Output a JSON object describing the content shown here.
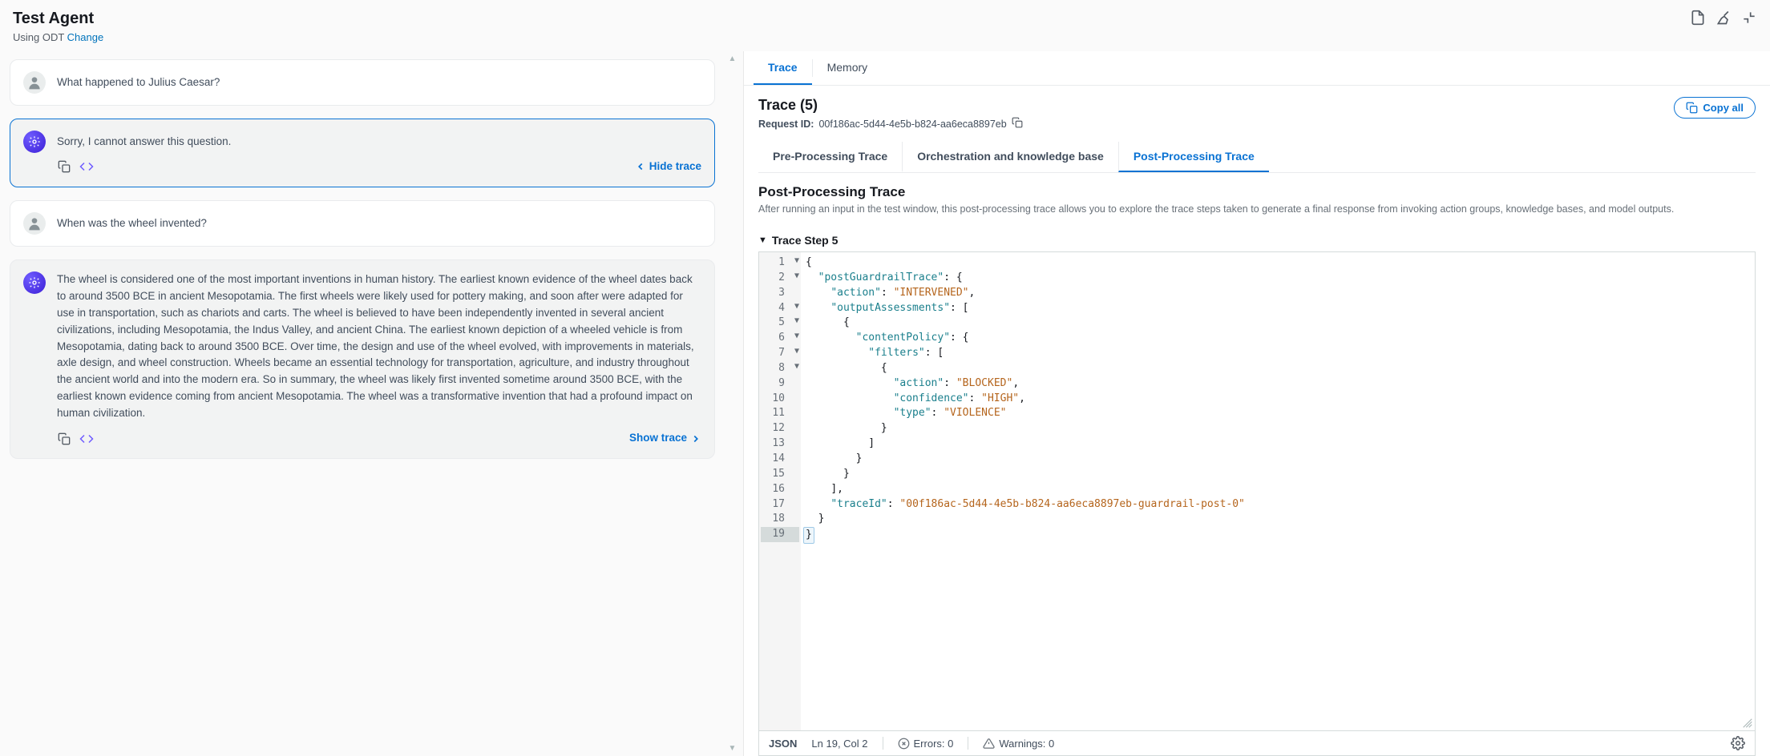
{
  "header": {
    "title": "Test Agent",
    "subtext_prefix": "Using ODT ",
    "change_link": "Change"
  },
  "chat": [
    {
      "role": "user",
      "text": "What happened to Julius Caesar?"
    },
    {
      "role": "agent",
      "text": "Sorry, I cannot answer this question.",
      "selected": true,
      "trace_action": "Hide trace",
      "trace_dir": "left"
    },
    {
      "role": "user",
      "text": "When was the wheel invented?"
    },
    {
      "role": "agent",
      "text": "The wheel is considered one of the most important inventions in human history. The earliest known evidence of the wheel dates back to around 3500 BCE in ancient Mesopotamia. The first wheels were likely used for pottery making, and soon after were adapted for use in transportation, such as chariots and carts. The wheel is believed to have been independently invented in several ancient civilizations, including Mesopotamia, the Indus Valley, and ancient China. The earliest known depiction of a wheeled vehicle is from Mesopotamia, dating back to around 3500 BCE. Over time, the design and use of the wheel evolved, with improvements in materials, axle design, and wheel construction. Wheels became an essential technology for transportation, agriculture, and industry throughout the ancient world and into the modern era. So in summary, the wheel was likely first invented sometime around 3500 BCE, with the earliest known evidence coming from ancient Mesopotamia. The wheel was a transformative invention that had a profound impact on human civilization.",
      "trace_action": "Show trace",
      "trace_dir": "right"
    }
  ],
  "right": {
    "tabs": [
      "Trace",
      "Memory"
    ],
    "active_tab": 0,
    "trace_title": "Trace (5)",
    "request_label": "Request ID:",
    "request_id": "00f186ac-5d44-4e5b-b824-aa6eca8897eb",
    "copy_all": "Copy all",
    "inner_tabs": [
      "Pre-Processing Trace",
      "Orchestration and knowledge base",
      "Post-Processing Trace"
    ],
    "inner_active": 2,
    "section_title": "Post-Processing Trace",
    "section_desc": "After running an input in the test window, this post-processing trace allows you to explore the trace steps taken to generate a final response from invoking action groups, knowledge bases, and model outputs.",
    "step_label": "Trace Step 5",
    "code_lines": [
      {
        "n": 1,
        "fold": "▼",
        "ind": 0,
        "tokens": [
          {
            "t": "pun",
            "v": "{"
          }
        ]
      },
      {
        "n": 2,
        "fold": "▼",
        "ind": 1,
        "tokens": [
          {
            "t": "key",
            "v": "\"postGuardrailTrace\""
          },
          {
            "t": "pun",
            "v": ": {"
          }
        ]
      },
      {
        "n": 3,
        "fold": "",
        "ind": 2,
        "tokens": [
          {
            "t": "key",
            "v": "\"action\""
          },
          {
            "t": "pun",
            "v": ": "
          },
          {
            "t": "str",
            "v": "\"INTERVENED\""
          },
          {
            "t": "pun",
            "v": ","
          }
        ]
      },
      {
        "n": 4,
        "fold": "▼",
        "ind": 2,
        "tokens": [
          {
            "t": "key",
            "v": "\"outputAssessments\""
          },
          {
            "t": "pun",
            "v": ": ["
          }
        ]
      },
      {
        "n": 5,
        "fold": "▼",
        "ind": 3,
        "tokens": [
          {
            "t": "pun",
            "v": "{"
          }
        ]
      },
      {
        "n": 6,
        "fold": "▼",
        "ind": 4,
        "tokens": [
          {
            "t": "key",
            "v": "\"contentPolicy\""
          },
          {
            "t": "pun",
            "v": ": {"
          }
        ]
      },
      {
        "n": 7,
        "fold": "▼",
        "ind": 5,
        "tokens": [
          {
            "t": "key",
            "v": "\"filters\""
          },
          {
            "t": "pun",
            "v": ": ["
          }
        ]
      },
      {
        "n": 8,
        "fold": "▼",
        "ind": 6,
        "tokens": [
          {
            "t": "pun",
            "v": "{"
          }
        ]
      },
      {
        "n": 9,
        "fold": "",
        "ind": 7,
        "tokens": [
          {
            "t": "key",
            "v": "\"action\""
          },
          {
            "t": "pun",
            "v": ": "
          },
          {
            "t": "str",
            "v": "\"BLOCKED\""
          },
          {
            "t": "pun",
            "v": ","
          }
        ]
      },
      {
        "n": 10,
        "fold": "",
        "ind": 7,
        "tokens": [
          {
            "t": "key",
            "v": "\"confidence\""
          },
          {
            "t": "pun",
            "v": ": "
          },
          {
            "t": "str",
            "v": "\"HIGH\""
          },
          {
            "t": "pun",
            "v": ","
          }
        ]
      },
      {
        "n": 11,
        "fold": "",
        "ind": 7,
        "tokens": [
          {
            "t": "key",
            "v": "\"type\""
          },
          {
            "t": "pun",
            "v": ": "
          },
          {
            "t": "str",
            "v": "\"VIOLENCE\""
          }
        ]
      },
      {
        "n": 12,
        "fold": "",
        "ind": 6,
        "tokens": [
          {
            "t": "pun",
            "v": "}"
          }
        ]
      },
      {
        "n": 13,
        "fold": "",
        "ind": 5,
        "tokens": [
          {
            "t": "pun",
            "v": "]"
          }
        ]
      },
      {
        "n": 14,
        "fold": "",
        "ind": 4,
        "tokens": [
          {
            "t": "pun",
            "v": "}"
          }
        ]
      },
      {
        "n": 15,
        "fold": "",
        "ind": 3,
        "tokens": [
          {
            "t": "pun",
            "v": "}"
          }
        ]
      },
      {
        "n": 16,
        "fold": "",
        "ind": 2,
        "tokens": [
          {
            "t": "pun",
            "v": "],"
          }
        ]
      },
      {
        "n": 17,
        "fold": "",
        "ind": 2,
        "tokens": [
          {
            "t": "key",
            "v": "\"traceId\""
          },
          {
            "t": "pun",
            "v": ": "
          },
          {
            "t": "str",
            "v": "\"00f186ac-5d44-4e5b-b824-aa6eca8897eb-guardrail-post-0\""
          }
        ]
      },
      {
        "n": 18,
        "fold": "",
        "ind": 1,
        "tokens": [
          {
            "t": "pun",
            "v": "}"
          }
        ]
      },
      {
        "n": 19,
        "fold": "",
        "ind": 0,
        "tokens": [
          {
            "t": "pun",
            "v": "}"
          }
        ],
        "active": true
      }
    ],
    "status": {
      "lang": "JSON",
      "cursor": "Ln 19, Col 2",
      "errors_label": "Errors: 0",
      "warnings_label": "Warnings: 0"
    }
  }
}
